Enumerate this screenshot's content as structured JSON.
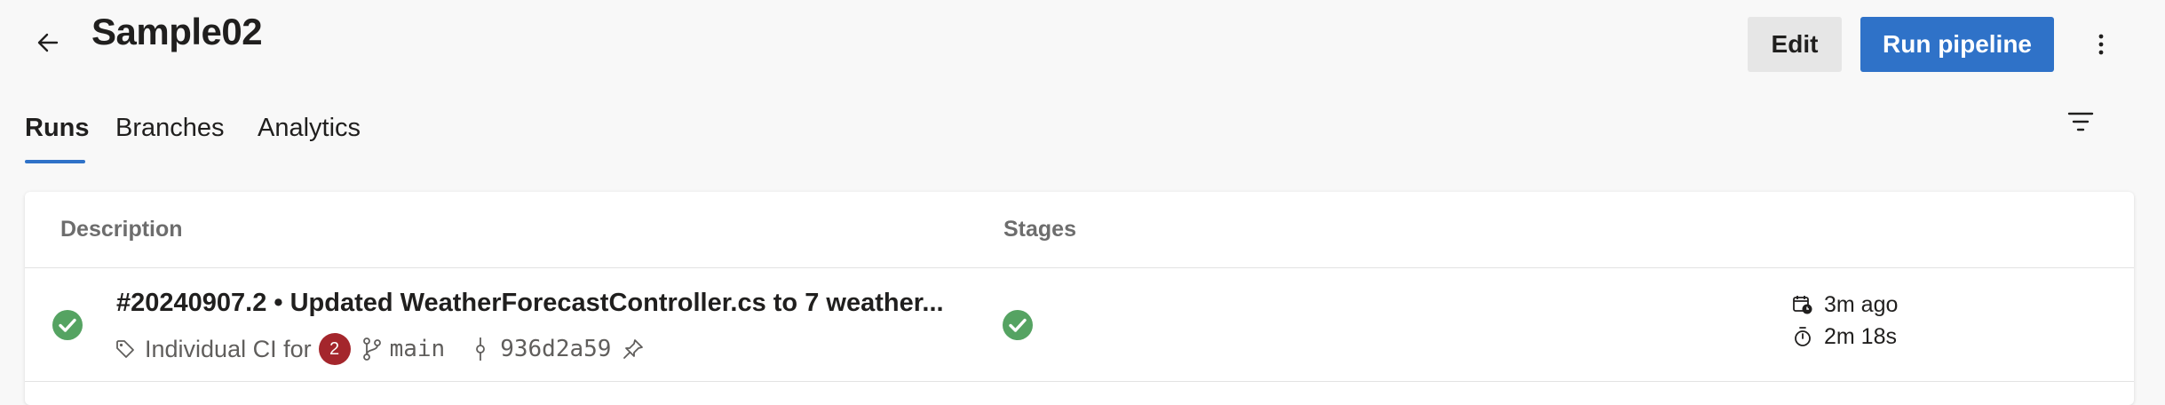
{
  "header": {
    "title": "Sample02",
    "edit_label": "Edit",
    "run_label": "Run pipeline"
  },
  "tabs": [
    {
      "label": "Runs",
      "active": true
    },
    {
      "label": "Branches",
      "active": false
    },
    {
      "label": "Analytics",
      "active": false
    }
  ],
  "table": {
    "columns": {
      "description": "Description",
      "stages": "Stages"
    },
    "rows": [
      {
        "status": "succeeded",
        "title": "#20240907.2 • Updated WeatherForecastController.cs to 7 weather...",
        "trigger": "Individual CI for",
        "changes_count": "2",
        "branch": "main",
        "commit": "936d2a59",
        "stage_status": "succeeded",
        "queued": "3m ago",
        "duration": "2m 18s"
      }
    ]
  },
  "colors": {
    "accent": "#2f72c8",
    "success": "#55a362",
    "badge": "#a4262c"
  },
  "icons": [
    "back-arrow-icon",
    "more-vertical-icon",
    "filter-icon",
    "success-check-icon",
    "tag-icon",
    "branch-icon",
    "commit-icon",
    "pin-icon",
    "calendar-clock-icon",
    "stopwatch-icon"
  ]
}
